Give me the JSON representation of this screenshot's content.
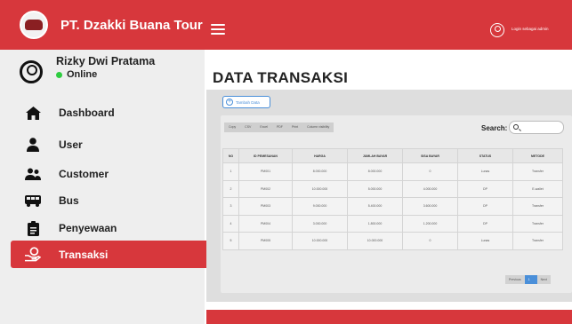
{
  "brand": {
    "name": "PT. Dzakki Buana Tour"
  },
  "header": {
    "login_text": "Login sebagai admin"
  },
  "profile": {
    "name": "Rizky Dwi Pratama",
    "status": "Online"
  },
  "sidebar": {
    "items": [
      {
        "label": "Dashboard",
        "icon": "home-icon",
        "active": false
      },
      {
        "label": "User",
        "icon": "user-icon",
        "active": false
      },
      {
        "label": "Customer",
        "icon": "users-icon",
        "active": false
      },
      {
        "label": "Bus",
        "icon": "bus-icon",
        "active": false
      },
      {
        "label": "Penyewaan",
        "icon": "clipboard-icon",
        "active": false
      },
      {
        "label": "Transaksi",
        "icon": "hand-money-icon",
        "active": true
      }
    ]
  },
  "main": {
    "title": "DATA TRANSAKSI",
    "add_button": "Tambah Data",
    "export_buttons": [
      "Copy",
      "CSV",
      "Excel",
      "PDF",
      "Print",
      "Column visibility"
    ],
    "search_label": "Search:",
    "table": {
      "headers": [
        "NO",
        "ID PEMESANAN",
        "HARGA",
        "JUMLAH BAYAR",
        "SISA BAYAR",
        "STATUS",
        "METODE"
      ],
      "rows": [
        [
          "1",
          "PM001",
          "8.000.000",
          "8.000.000",
          "0",
          "Lunas",
          "Transfer"
        ],
        [
          "2",
          "PM002",
          "10.000.000",
          "5.000.000",
          "4.000.000",
          "DP",
          "E-wallet"
        ],
        [
          "3",
          "PM003",
          "9.000.000",
          "5.400.000",
          "3.600.000",
          "DP",
          "Transfer"
        ],
        [
          "4",
          "PM004",
          "3.000.000",
          "1.800.000",
          "1.200.000",
          "DP",
          "Transfer"
        ],
        [
          "5",
          "PM005",
          "10.000.000",
          "10.000.000",
          "0",
          "Lunas",
          "Transfer"
        ]
      ]
    },
    "pagination": {
      "previous": "Previous",
      "current": "1",
      "next": "Next"
    }
  },
  "colors": {
    "accent": "#d7373c",
    "sidebar_bg": "#eeeeee",
    "panel_bg": "#dedede",
    "link": "#4a8fd9"
  }
}
